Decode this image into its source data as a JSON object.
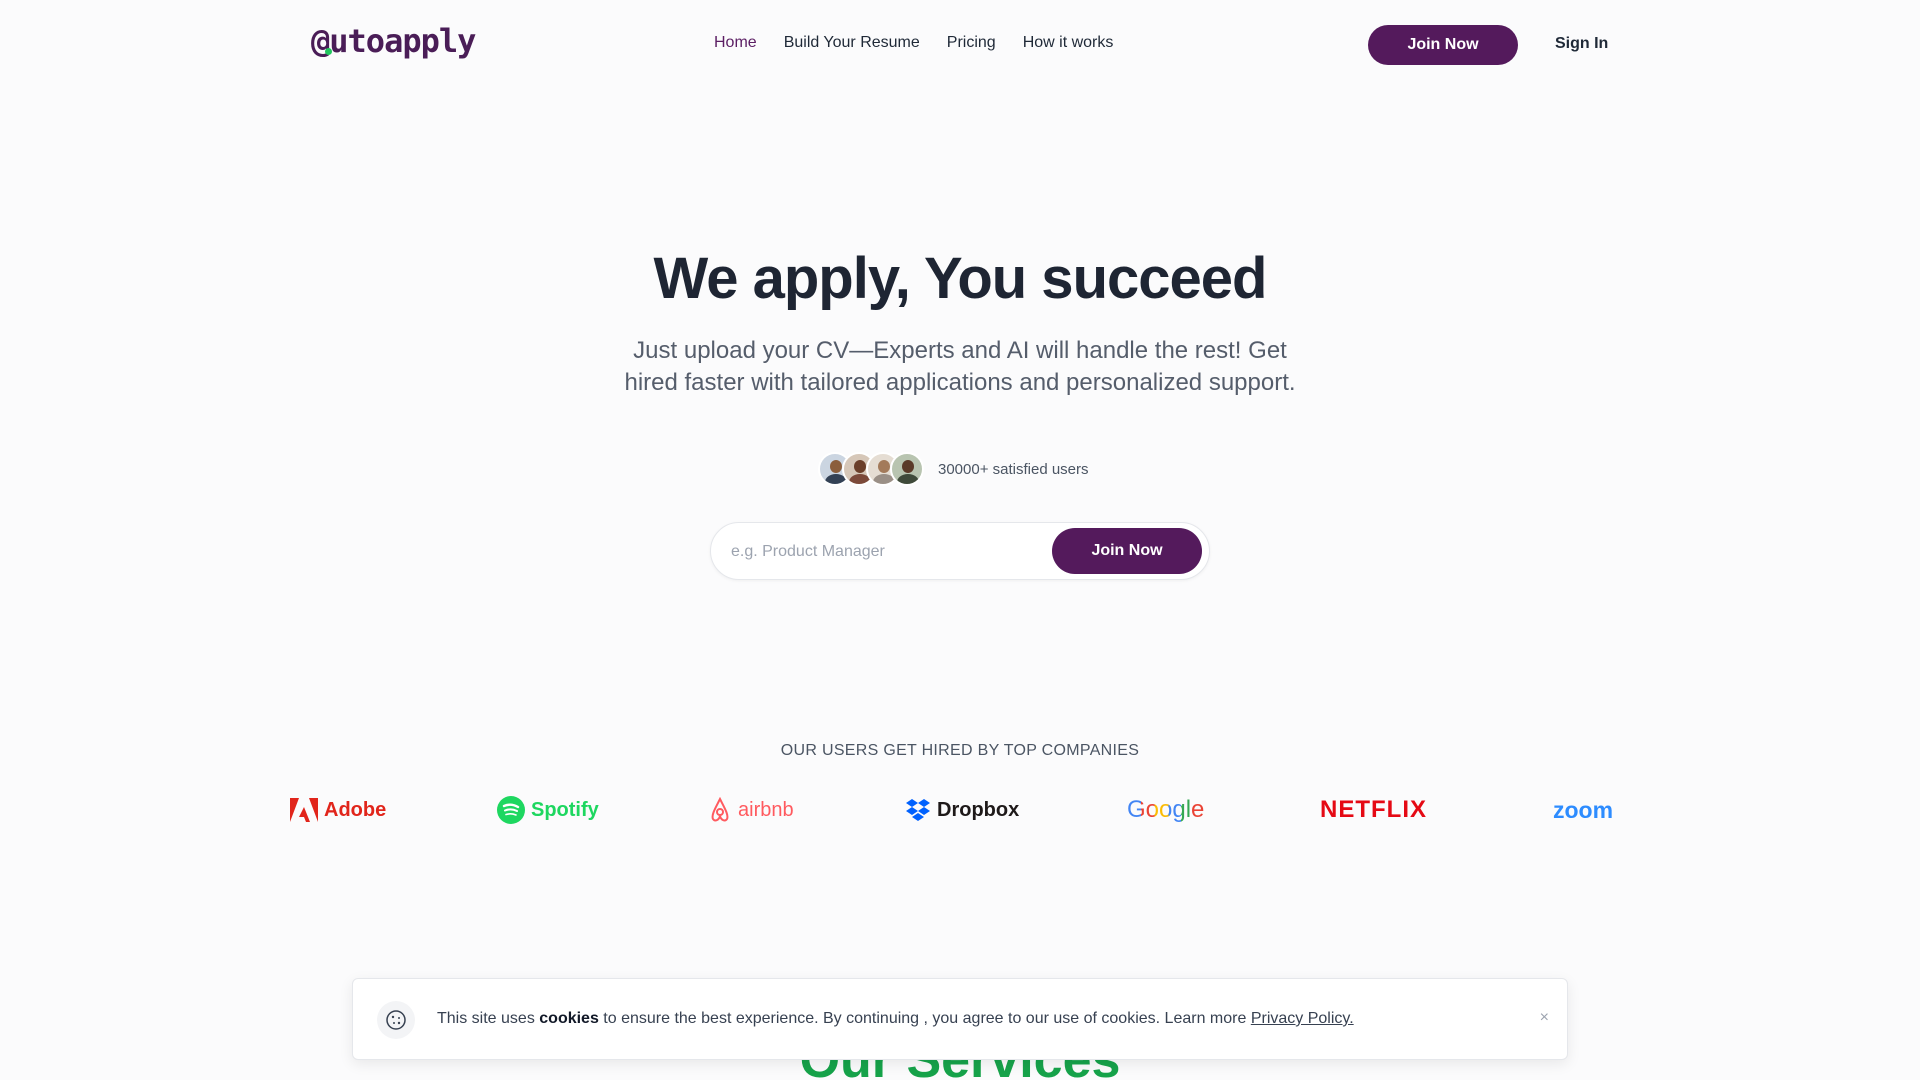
{
  "nav": {
    "logo_prefix": "@",
    "logo_rest": "utoapply",
    "links": [
      {
        "label": "Home",
        "active": true
      },
      {
        "label": "Build Your Resume",
        "active": false
      },
      {
        "label": "Pricing",
        "active": false
      },
      {
        "label": "How it works",
        "active": false
      }
    ],
    "join_label": "Join Now",
    "sign_in_label": "Sign In"
  },
  "hero": {
    "title": "We apply, You succeed",
    "subtitle": "Just upload your CV—Experts and AI will handle the rest! Get hired faster with tailored applications and personalized support.",
    "users_text": "30000+ satisfied users",
    "search_placeholder": "e.g. Product Manager",
    "join_label": "Join Now"
  },
  "companies": {
    "label": "OUR USERS GET HIRED BY TOP COMPANIES",
    "items": [
      {
        "name": "Adobe",
        "color": "#e1251b"
      },
      {
        "name": "Spotify",
        "color": "#1ed760"
      },
      {
        "name": "airbnb",
        "color": "#ff5a5f"
      },
      {
        "name": "Dropbox",
        "color": "#0061fe"
      },
      {
        "name": "Google",
        "color": "#4285f4"
      },
      {
        "name": "NETFLIX",
        "color": "#e50914"
      },
      {
        "name": "zoom",
        "color": "#2d8cff"
      }
    ]
  },
  "services_heading": "Our Services",
  "cookie": {
    "text_before": "This site uses ",
    "text_bold": "cookies",
    "text_after": " to ensure the best experience. By continuing , you agree to our use of cookies. Learn more ",
    "link_label": "Privacy Policy.",
    "close_label": "×"
  },
  "colors": {
    "brand": "#541a5c",
    "accent_green": "#16a34a"
  }
}
